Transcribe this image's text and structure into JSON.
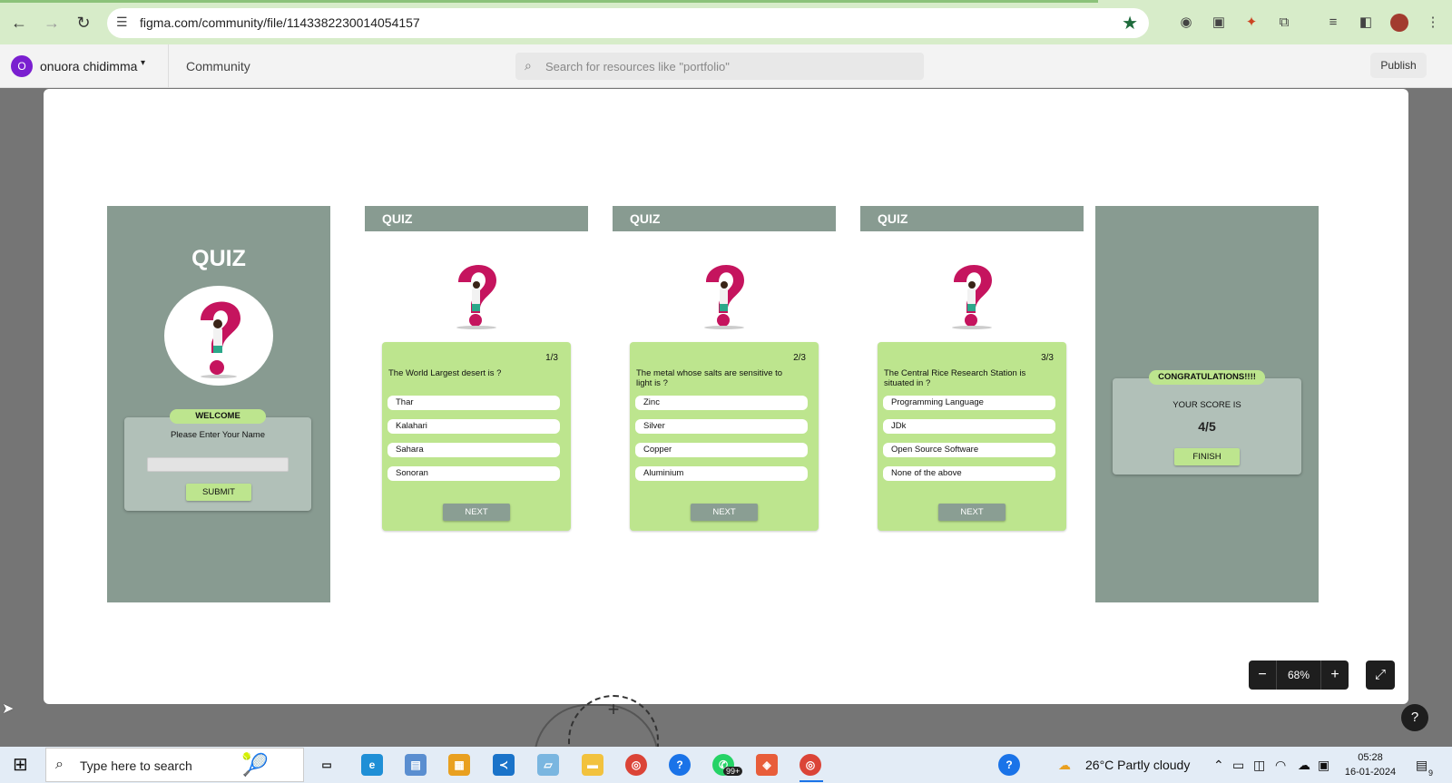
{
  "browser": {
    "url": "figma.com/community/file/1143382230014054157"
  },
  "figma": {
    "avatar_letter": "O",
    "user_name": "onuora chidimma",
    "community_label": "Community",
    "search_placeholder": "Search for resources like \"portfolio\"",
    "publish_label": "Publish"
  },
  "screens": {
    "welcome": {
      "title": "QUIZ",
      "badge": "WELCOME",
      "prompt": "Please Enter Your Name",
      "name_value": "",
      "submit_label": "SUBMIT"
    },
    "questions": [
      {
        "header": "QUIZ",
        "counter": "1/3",
        "question": "The World Largest desert is ?",
        "options": [
          "Thar",
          "Kalahari",
          "Sahara",
          "Sonoran"
        ],
        "next_label": "NEXT"
      },
      {
        "header": "QUIZ",
        "counter": "2/3",
        "question": "The metal whose salts are sensitive to light is ?",
        "options": [
          "Zinc",
          "Silver",
          "Copper",
          "Aluminium"
        ],
        "next_label": "NEXT"
      },
      {
        "header": "QUIZ",
        "counter": "3/3",
        "question": "The Central Rice Research Station is situated in ?",
        "options": [
          "Programming Language",
          "JDk",
          "Open Source Software",
          "None of the above"
        ],
        "next_label": "NEXT"
      }
    ],
    "result": {
      "badge": "CONGRATULATIONS!!!!",
      "score_label": "YOUR SCORE IS",
      "score": "4/5",
      "finish_label": "FINISH"
    }
  },
  "viewer": {
    "zoom_out": "−",
    "zoom_level": "68%",
    "zoom_in": "+",
    "help": "?"
  },
  "taskbar": {
    "search_placeholder": "Type here to search",
    "whatsapp_badge": "99+",
    "weather": "26°C  Partly cloudy",
    "time": "05:28",
    "date": "16-01-2024",
    "notification_count": "9"
  },
  "colors": {
    "frame_sage": "#889b91",
    "card_green": "#bde58e",
    "accent_magenta": "#c5145e",
    "browser_bar": "#d7ecc9"
  }
}
